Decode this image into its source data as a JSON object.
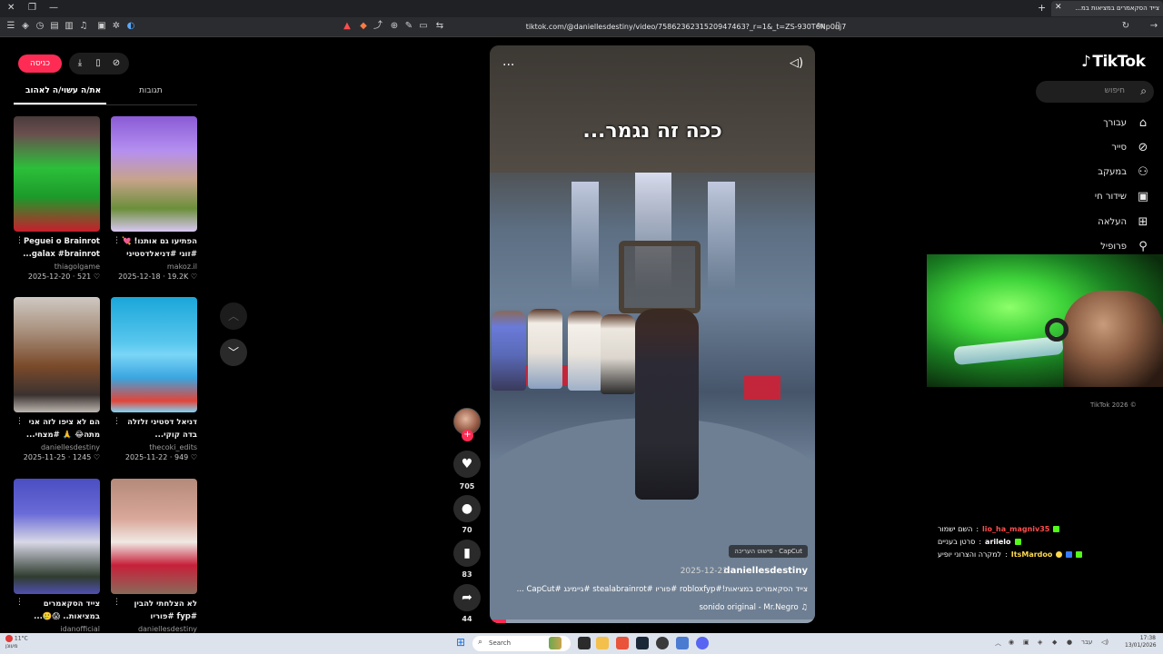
{
  "browser": {
    "tab_title": "צייד הסקאמרים במציאות במ...",
    "url": "tiktok.com/@daniellesdestiny/video/7586236231520947463?_r=1&_t=ZS-930T6Np0nj7"
  },
  "nav": {
    "logo": "TikTok",
    "search_placeholder": "חיפוש",
    "items": [
      {
        "label": "עבורך",
        "icon": "home-icon"
      },
      {
        "label": "סייר",
        "icon": "compass-icon"
      },
      {
        "label": "במעקב",
        "icon": "following-icon"
      },
      {
        "label": "שידור חי",
        "icon": "live-icon"
      },
      {
        "label": "העלאה",
        "icon": "upload-icon"
      },
      {
        "label": "פרופיל",
        "icon": "profile-icon"
      }
    ],
    "copyright": "TikTok 2026 ©"
  },
  "left_panel": {
    "login": "כניסה",
    "tab_recommended": "את/ה עשוי/ה לאהוב",
    "tab_comments": "תגובות",
    "videos": [
      {
        "title": "Peguei o Brainrot galax #brainrot...",
        "author": "thiagolgame",
        "date": "2025-12-20",
        "likes": "521"
      },
      {
        "title": "הפתיעו גם אותנו! 💘 #זוגי #דניאלדסטיני",
        "author": "makoz.il",
        "date": "2025-12-18",
        "likes": "19.2K"
      },
      {
        "title": "הם לא ציפו לזה אני מתה😂 🙏 #מצחי...",
        "author": "daniellesdestiny",
        "date": "2025-11-25",
        "likes": "1245"
      },
      {
        "title": "דניאל דסטיני זלזלה בדה קוקי... #mmy...",
        "author": "thecoki_edits",
        "date": "2025-11-22",
        "likes": "949"
      },
      {
        "title": "צייד הסקאמרים במציאות.. 😱🥲...",
        "author": "idanofficial",
        "date": "",
        "likes": ""
      },
      {
        "title": "לא הצלחתי להבין #fyp #פוריו #מצחיק",
        "author": "daniellesdestiny",
        "date": "",
        "likes": ""
      }
    ]
  },
  "video": {
    "caption_overlay": "ככה זה נגמר...",
    "capcut": "CapCut · פישוט העריכה",
    "author": "daniellesdestiny",
    "date": "2025-12-21",
    "description": "צייד הסקאמרים במציאות!#robloxfyp #פוריו #stealabrainrot #גיימינג #CapCut ...",
    "sound": "sonido original - Mr.Negro",
    "progress": 0.05
  },
  "actions": {
    "likes": "705",
    "comments": "70",
    "saves": "83",
    "shares": "44"
  },
  "chat": [
    {
      "user": "lio_ha_magniv35",
      "msg": "השם ישמור",
      "color": "#ff4d4d"
    },
    {
      "user": "arilelo",
      "msg": "סרטן בעניים",
      "color": "#ffffff"
    },
    {
      "user": "ItsMardoo",
      "msg": "למקרה והצרוני יופיע",
      "color": "#ffd84d"
    }
  ],
  "taskbar": {
    "weather_temp": "11°C",
    "weather_desc": "מעונן",
    "search": "Search",
    "lang": "עבר",
    "time": "17:38",
    "date": "13/01/2026"
  }
}
